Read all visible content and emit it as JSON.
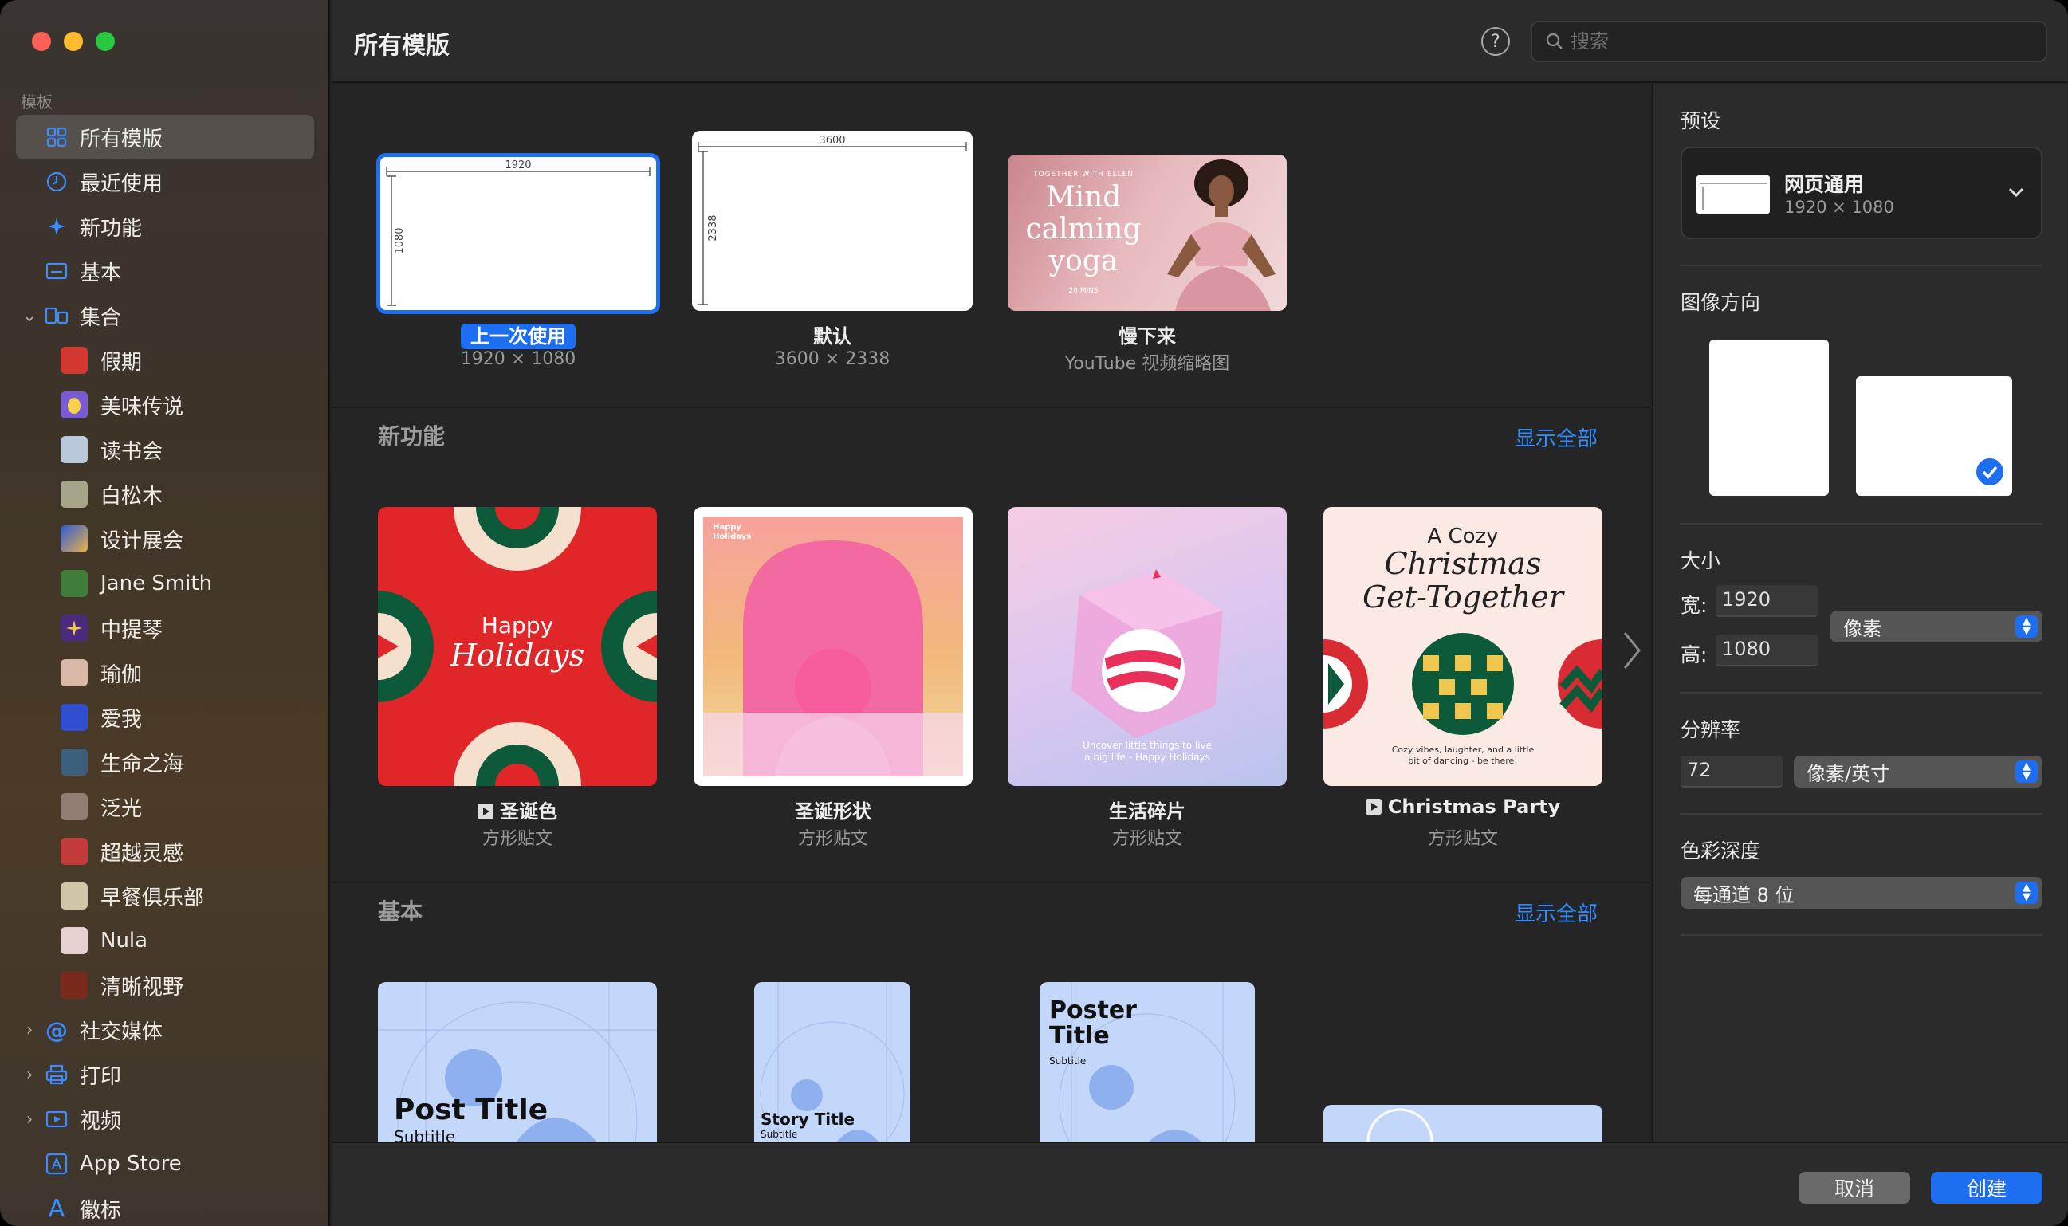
{
  "sidebar": {
    "section": "模板",
    "items": [
      {
        "label": "所有模版",
        "icon": "grid-icon"
      },
      {
        "label": "最近使用",
        "icon": "clock-icon"
      },
      {
        "label": "新功能",
        "icon": "sparkle-icon"
      },
      {
        "label": "基本",
        "icon": "basic-rect-icon"
      },
      {
        "label": "集合",
        "icon": "collection-icon"
      },
      {
        "label": "假期",
        "icon": "holiday-app-icon"
      },
      {
        "label": "美味传说",
        "icon": "egg-app-icon"
      },
      {
        "label": "读书会",
        "icon": "book-club-app-icon"
      },
      {
        "label": "白松木",
        "icon": "pine-app-icon"
      },
      {
        "label": "设计展会",
        "icon": "design-fair-app-icon"
      },
      {
        "label": "Jane Smith",
        "icon": "jane-smith-app-icon"
      },
      {
        "label": "中提琴",
        "icon": "viola-app-icon"
      },
      {
        "label": "瑜伽",
        "icon": "yoga-app-icon"
      },
      {
        "label": "爱我",
        "icon": "love-me-app-icon"
      },
      {
        "label": "生命之海",
        "icon": "sea-of-life-app-icon"
      },
      {
        "label": "泛光",
        "icon": "glow-app-icon"
      },
      {
        "label": "超越灵感",
        "icon": "inspiration-app-icon"
      },
      {
        "label": "早餐俱乐部",
        "icon": "breakfast-club-app-icon"
      },
      {
        "label": "Nula",
        "icon": "nula-app-icon"
      },
      {
        "label": "清晰视野",
        "icon": "clear-view-app-icon"
      },
      {
        "label": "社交媒体",
        "icon": "at-sign-icon"
      },
      {
        "label": "打印",
        "icon": "printer-icon"
      },
      {
        "label": "视频",
        "icon": "video-icon"
      },
      {
        "label": "App Store",
        "icon": "app-store-icon"
      },
      {
        "label": "徽标",
        "icon": "logo-a-icon"
      }
    ]
  },
  "header": {
    "title": "所有模版",
    "search_placeholder": "搜索"
  },
  "recent": [
    {
      "title": "上一次使用",
      "subtitle": "1920 × 1080",
      "w": "1920",
      "h": "1080"
    },
    {
      "title": "默认",
      "subtitle": "3600 × 2338",
      "w": "3600",
      "h": "2338"
    },
    {
      "title": "慢下来",
      "subtitle": "YouTube 视频缩略图",
      "small": "TOGETHER WITH ELLEN",
      "line1": "Mind",
      "line2": "calming",
      "line3": "yoga",
      "mins": "20 MINS"
    }
  ],
  "new_features": {
    "title": "新功能",
    "show_all": "显示全部",
    "cards": [
      {
        "title": "圣诞色",
        "subtitle": "方形贴文",
        "art1": "Happy",
        "art2": "Holidays"
      },
      {
        "title": "圣诞形状",
        "subtitle": "方形贴文",
        "art1": "Happy",
        "art2": "Holidays"
      },
      {
        "title": "生活碎片",
        "subtitle": "方形贴文",
        "art1": "Uncover little things to live",
        "art2": "a big life - Happy Holidays"
      },
      {
        "title": "Christmas Party",
        "subtitle": "方形贴文",
        "art1": "A Cozy",
        "art2": "Christmas",
        "art3": "Get-Together",
        "art4": "Cozy vibes, laughter, and a little",
        "art5": "bit of dancing - be there!"
      }
    ]
  },
  "basic": {
    "title": "基本",
    "show_all": "显示全部",
    "cards": [
      {
        "art1": "Post Title",
        "art2": "Subtitle"
      },
      {
        "art1": "Story Title",
        "art2": "Subtitle"
      },
      {
        "art1": "Poster",
        "art2": "Title",
        "art3": "Subtitle"
      }
    ]
  },
  "panel": {
    "preset_label": "预设",
    "preset_name": "网页通用",
    "preset_size": "1920 × 1080",
    "orientation_label": "图像方向",
    "size_label": "大小",
    "width_label": "宽:",
    "width_value": "1920",
    "height_label": "高:",
    "height_value": "1080",
    "unit": "像素",
    "resolution_label": "分辨率",
    "resolution_value": "72",
    "resolution_unit": "像素/英寸",
    "depth_label": "色彩深度",
    "depth_value": "每通道 8 位"
  },
  "footer": {
    "cancel": "取消",
    "create": "创建"
  },
  "colors": {
    "accent": "#1d6ef0",
    "link": "#2f8bff"
  }
}
